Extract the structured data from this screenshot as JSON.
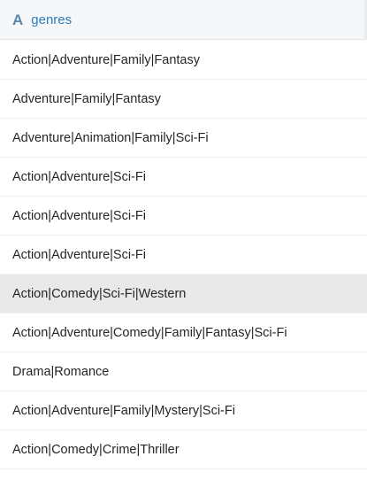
{
  "column": {
    "type_icon": "A",
    "type_icon_name": "text-type-icon",
    "name": "genres"
  },
  "rows": [
    "Action|Adventure|Family|Fantasy",
    "Adventure|Family|Fantasy",
    "Adventure|Animation|Family|Sci-Fi",
    "Action|Adventure|Sci-Fi",
    "Action|Adventure|Sci-Fi",
    "Action|Adventure|Sci-Fi",
    "Action|Comedy|Sci-Fi|Western",
    "Action|Adventure|Comedy|Family|Fantasy|Sci-Fi",
    "Drama|Romance",
    "Action|Adventure|Family|Mystery|Sci-Fi",
    "Action|Comedy|Crime|Thriller",
    ""
  ],
  "selected_row_index": 6,
  "colors": {
    "header_label": "#2e7cbf",
    "type_icon": "#5b86a8",
    "header_bg": "#f6f7f9",
    "selected_row_bg": "#e9e9ea"
  }
}
